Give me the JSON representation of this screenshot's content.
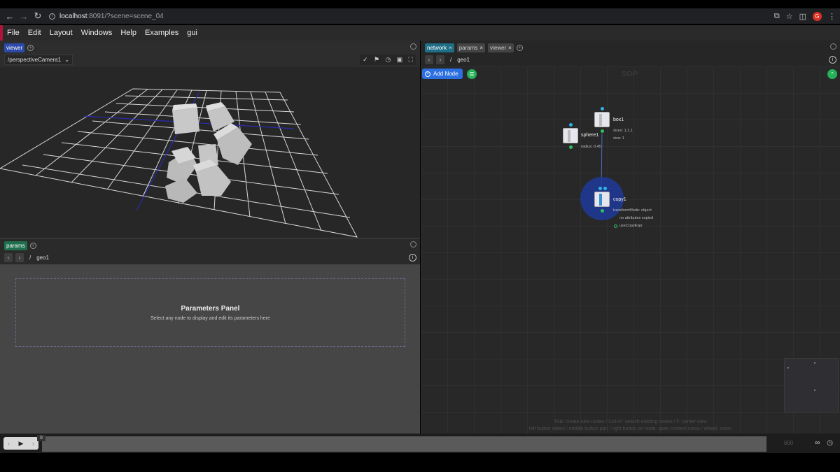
{
  "browser": {
    "url_host": "localhost",
    "url_path": ":8091/?scene=scene_04",
    "avatar_letter": "G"
  },
  "menu": {
    "items": [
      "File",
      "Edit",
      "Layout",
      "Windows",
      "Help",
      "Examples",
      "gui"
    ]
  },
  "viewer": {
    "tab_label": "viewer",
    "camera": "/perspectiveCamera1"
  },
  "params": {
    "tab_label": "params",
    "path_root": "/",
    "path_node": "geo1",
    "panel_title": "Parameters Panel",
    "panel_subtitle": "Select any node to display and edit its parameters here"
  },
  "network": {
    "tabs": [
      {
        "label": "network",
        "style": "teal"
      },
      {
        "label": "params",
        "style": "grey"
      },
      {
        "label": "viewer",
        "style": "grey"
      }
    ],
    "path_root": "/",
    "path_node": "geo1",
    "add_node_label": "Add Node",
    "context_label": "SOP",
    "nodes": {
      "box": {
        "name": "box1",
        "params": [
          "sizes: 1,1,1",
          "size: 1"
        ]
      },
      "sphere": {
        "name": "sphere1",
        "params": [
          "radius: 0.45"
        ]
      },
      "copy": {
        "name": "copy1",
        "params": [
          "transformMode: object",
          "no attributes copied",
          "useCopyExpr"
        ]
      }
    },
    "hint_line1": "TAB: create new nodes / Ctrl+P: search existing nodes / F: center view",
    "hint_line2": "left button select / middle button pan / right button on node: open context menu / wheel: zoom"
  },
  "timeline": {
    "current_frame": "0",
    "end_frame": "600"
  },
  "colors": {
    "accent_blue": "#2b6fe0",
    "accent_green": "#27b05a",
    "input_dot": "#2eb2e6",
    "output_dot": "#30c060"
  }
}
